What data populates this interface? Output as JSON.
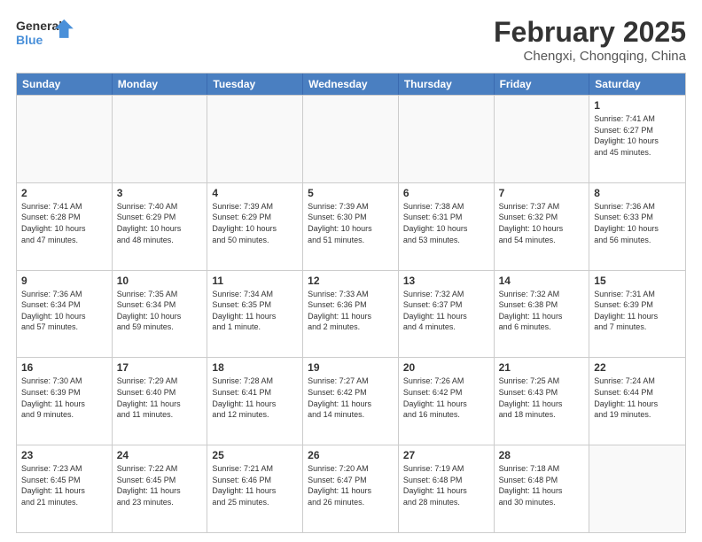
{
  "logo": {
    "line1": "General",
    "line2": "Blue"
  },
  "title": "February 2025",
  "subtitle": "Chengxi, Chongqing, China",
  "days": [
    "Sunday",
    "Monday",
    "Tuesday",
    "Wednesday",
    "Thursday",
    "Friday",
    "Saturday"
  ],
  "weeks": [
    [
      {
        "day": "",
        "text": ""
      },
      {
        "day": "",
        "text": ""
      },
      {
        "day": "",
        "text": ""
      },
      {
        "day": "",
        "text": ""
      },
      {
        "day": "",
        "text": ""
      },
      {
        "day": "",
        "text": ""
      },
      {
        "day": "1",
        "text": "Sunrise: 7:41 AM\nSunset: 6:27 PM\nDaylight: 10 hours\nand 45 minutes."
      }
    ],
    [
      {
        "day": "2",
        "text": "Sunrise: 7:41 AM\nSunset: 6:28 PM\nDaylight: 10 hours\nand 47 minutes."
      },
      {
        "day": "3",
        "text": "Sunrise: 7:40 AM\nSunset: 6:29 PM\nDaylight: 10 hours\nand 48 minutes."
      },
      {
        "day": "4",
        "text": "Sunrise: 7:39 AM\nSunset: 6:29 PM\nDaylight: 10 hours\nand 50 minutes."
      },
      {
        "day": "5",
        "text": "Sunrise: 7:39 AM\nSunset: 6:30 PM\nDaylight: 10 hours\nand 51 minutes."
      },
      {
        "day": "6",
        "text": "Sunrise: 7:38 AM\nSunset: 6:31 PM\nDaylight: 10 hours\nand 53 minutes."
      },
      {
        "day": "7",
        "text": "Sunrise: 7:37 AM\nSunset: 6:32 PM\nDaylight: 10 hours\nand 54 minutes."
      },
      {
        "day": "8",
        "text": "Sunrise: 7:36 AM\nSunset: 6:33 PM\nDaylight: 10 hours\nand 56 minutes."
      }
    ],
    [
      {
        "day": "9",
        "text": "Sunrise: 7:36 AM\nSunset: 6:34 PM\nDaylight: 10 hours\nand 57 minutes."
      },
      {
        "day": "10",
        "text": "Sunrise: 7:35 AM\nSunset: 6:34 PM\nDaylight: 10 hours\nand 59 minutes."
      },
      {
        "day": "11",
        "text": "Sunrise: 7:34 AM\nSunset: 6:35 PM\nDaylight: 11 hours\nand 1 minute."
      },
      {
        "day": "12",
        "text": "Sunrise: 7:33 AM\nSunset: 6:36 PM\nDaylight: 11 hours\nand 2 minutes."
      },
      {
        "day": "13",
        "text": "Sunrise: 7:32 AM\nSunset: 6:37 PM\nDaylight: 11 hours\nand 4 minutes."
      },
      {
        "day": "14",
        "text": "Sunrise: 7:32 AM\nSunset: 6:38 PM\nDaylight: 11 hours\nand 6 minutes."
      },
      {
        "day": "15",
        "text": "Sunrise: 7:31 AM\nSunset: 6:39 PM\nDaylight: 11 hours\nand 7 minutes."
      }
    ],
    [
      {
        "day": "16",
        "text": "Sunrise: 7:30 AM\nSunset: 6:39 PM\nDaylight: 11 hours\nand 9 minutes."
      },
      {
        "day": "17",
        "text": "Sunrise: 7:29 AM\nSunset: 6:40 PM\nDaylight: 11 hours\nand 11 minutes."
      },
      {
        "day": "18",
        "text": "Sunrise: 7:28 AM\nSunset: 6:41 PM\nDaylight: 11 hours\nand 12 minutes."
      },
      {
        "day": "19",
        "text": "Sunrise: 7:27 AM\nSunset: 6:42 PM\nDaylight: 11 hours\nand 14 minutes."
      },
      {
        "day": "20",
        "text": "Sunrise: 7:26 AM\nSunset: 6:42 PM\nDaylight: 11 hours\nand 16 minutes."
      },
      {
        "day": "21",
        "text": "Sunrise: 7:25 AM\nSunset: 6:43 PM\nDaylight: 11 hours\nand 18 minutes."
      },
      {
        "day": "22",
        "text": "Sunrise: 7:24 AM\nSunset: 6:44 PM\nDaylight: 11 hours\nand 19 minutes."
      }
    ],
    [
      {
        "day": "23",
        "text": "Sunrise: 7:23 AM\nSunset: 6:45 PM\nDaylight: 11 hours\nand 21 minutes."
      },
      {
        "day": "24",
        "text": "Sunrise: 7:22 AM\nSunset: 6:45 PM\nDaylight: 11 hours\nand 23 minutes."
      },
      {
        "day": "25",
        "text": "Sunrise: 7:21 AM\nSunset: 6:46 PM\nDaylight: 11 hours\nand 25 minutes."
      },
      {
        "day": "26",
        "text": "Sunrise: 7:20 AM\nSunset: 6:47 PM\nDaylight: 11 hours\nand 26 minutes."
      },
      {
        "day": "27",
        "text": "Sunrise: 7:19 AM\nSunset: 6:48 PM\nDaylight: 11 hours\nand 28 minutes."
      },
      {
        "day": "28",
        "text": "Sunrise: 7:18 AM\nSunset: 6:48 PM\nDaylight: 11 hours\nand 30 minutes."
      },
      {
        "day": "",
        "text": ""
      }
    ]
  ]
}
